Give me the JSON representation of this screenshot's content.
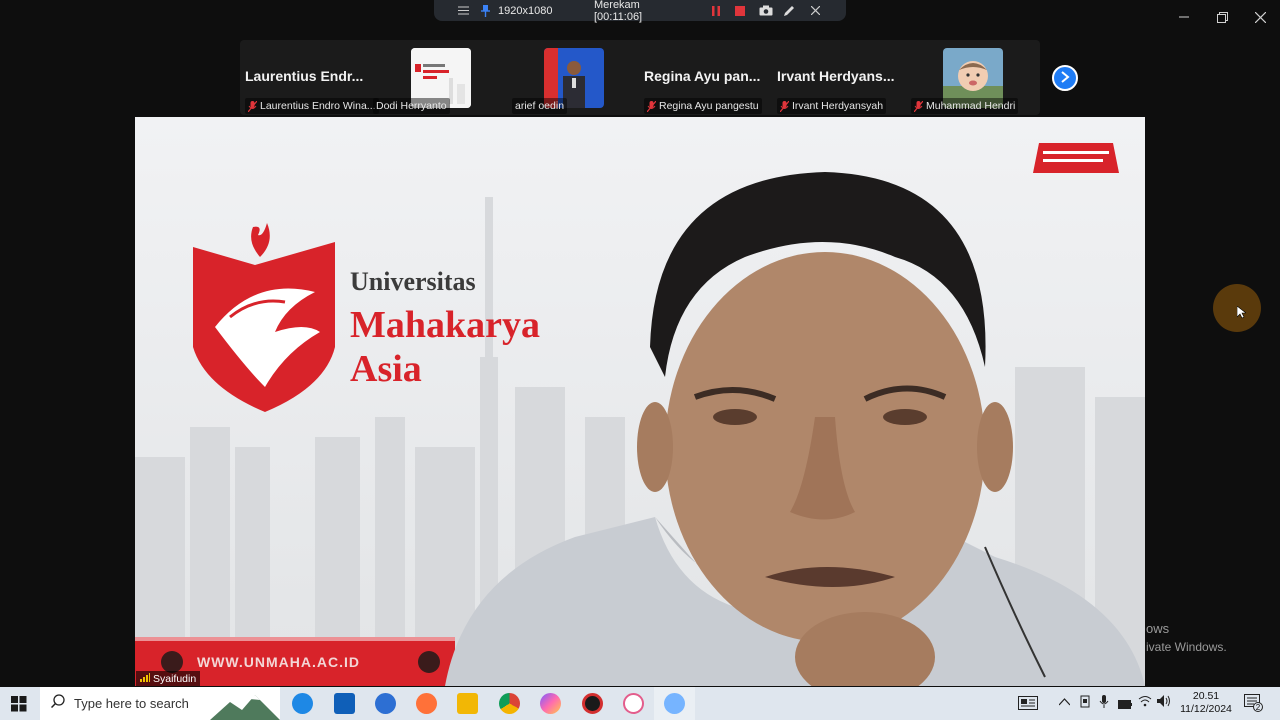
{
  "recorder": {
    "resolution": "1920x1080",
    "status": "Merekam [00:11:06]",
    "icons": [
      "menu-icon",
      "pin-icon",
      "pause-icon",
      "stop-icon",
      "camera-icon",
      "pen-icon",
      "close-icon"
    ]
  },
  "window_controls": [
    "minimize-icon",
    "restore-icon",
    "close-icon"
  ],
  "participants": [
    {
      "display": "Laurentius Endr...",
      "name": "Laurentius Endro Wina...",
      "muted": true
    },
    {
      "display": "",
      "name": "Dodi Herryanto",
      "muted": false
    },
    {
      "display": "",
      "name": "arief oedin",
      "muted": false
    },
    {
      "display": "Regina Ayu pan...",
      "name": "Regina Ayu pangestu",
      "muted": true
    },
    {
      "display": "Irvant Herdyans...",
      "name": "Irvant Herdyansyah",
      "muted": true
    },
    {
      "display": "",
      "name": "Muhammad Hendri",
      "muted": true
    }
  ],
  "speaker": {
    "name": "Syaifudin"
  },
  "background": {
    "logo_line1": "Universitas",
    "logo_line2": "Mahakarya",
    "logo_line3": "Asia",
    "website": "WWW.UNMAHA.AC.ID"
  },
  "watermark": {
    "line1": "ows",
    "line2": "ivate Windows."
  },
  "taskbar": {
    "search_placeholder": "Type here to search",
    "time": "20.51",
    "date": "11/12/2024",
    "notification_count": "2"
  },
  "colors": {
    "brand_red": "#d8232a",
    "zoom_blue": "#2d8cff",
    "recording_red": "#e0353b"
  }
}
